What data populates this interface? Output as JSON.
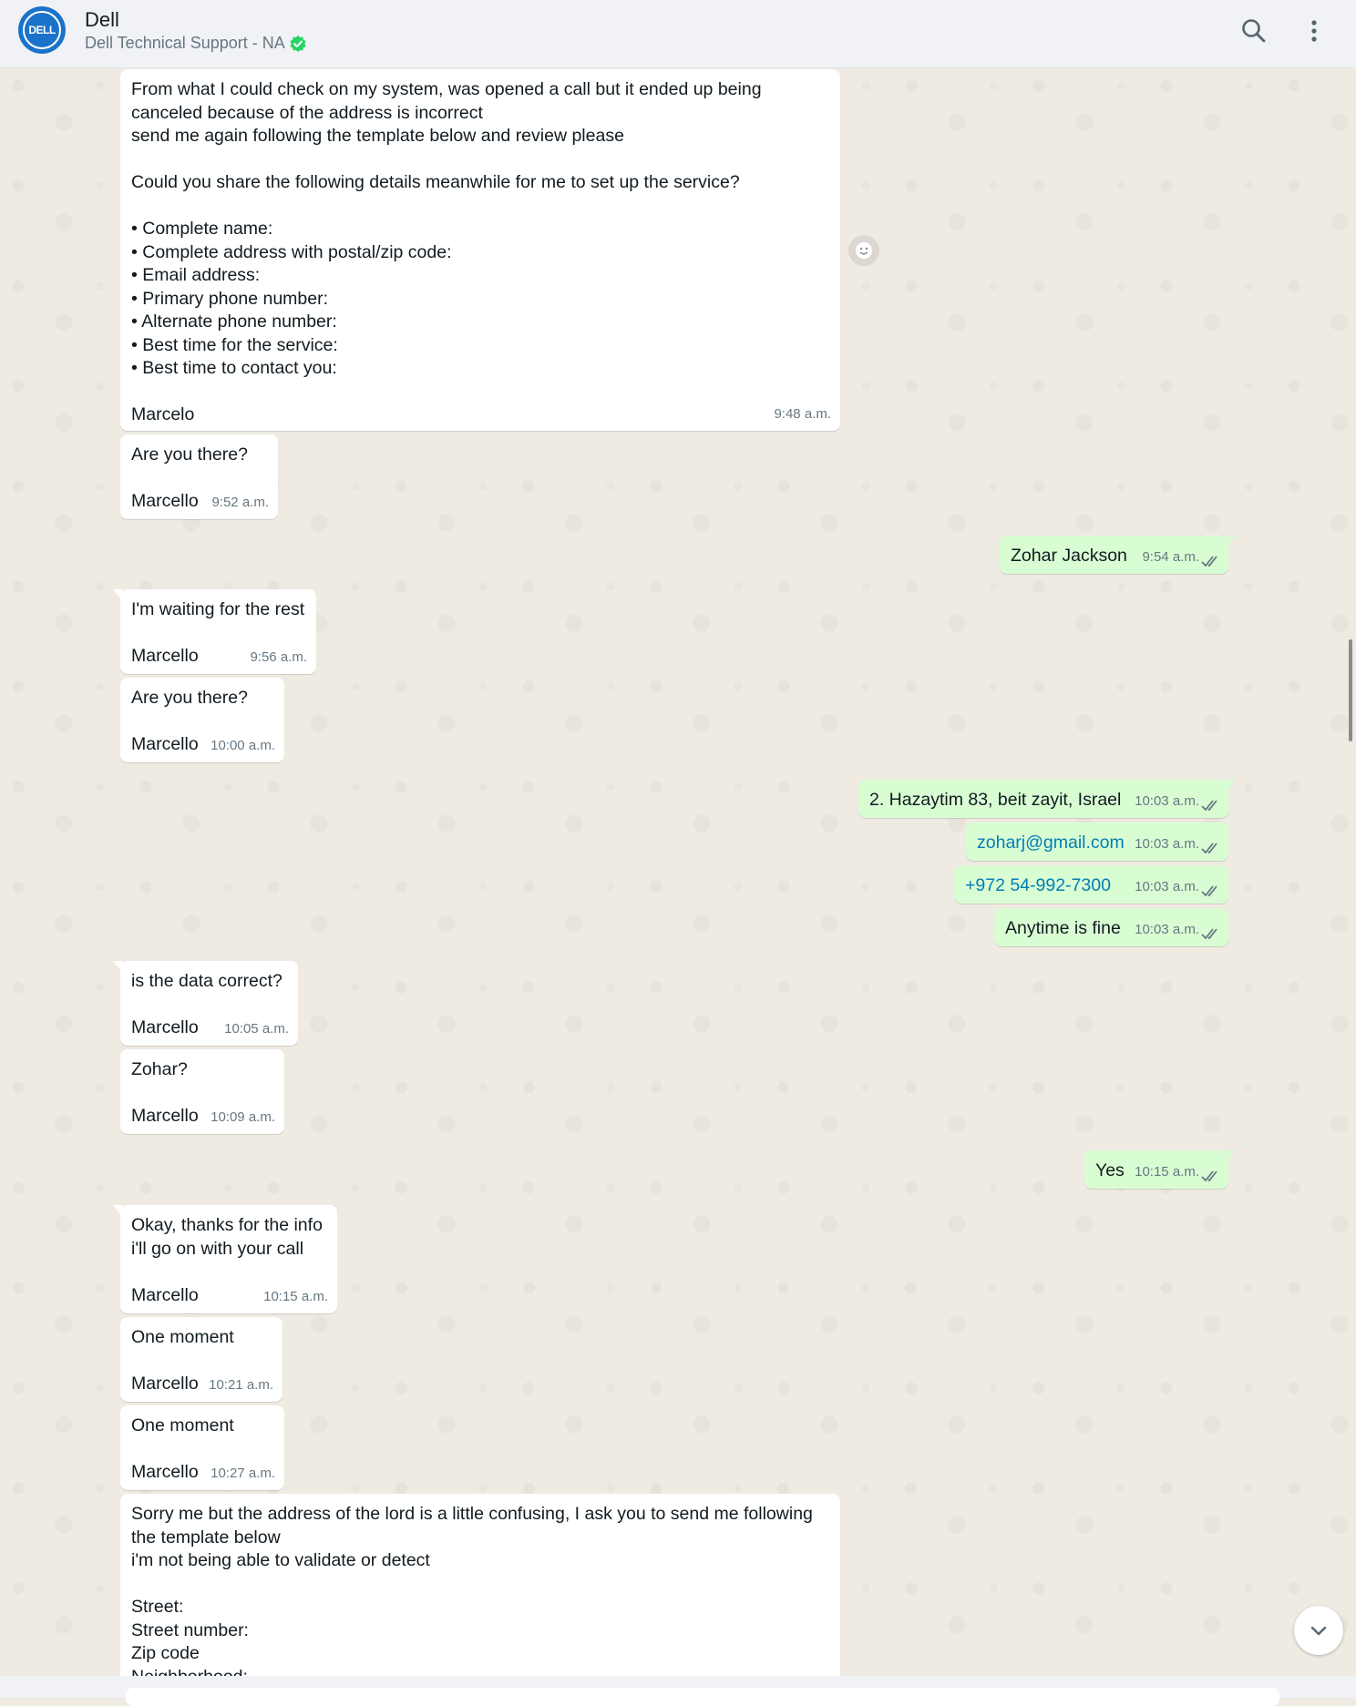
{
  "header": {
    "name": "Dell",
    "subtitle": "Dell Technical Support - NA",
    "avatar_text": "DELL"
  },
  "colors": {
    "incoming": "#ffffff",
    "outgoing": "#d9fdd3",
    "link": "#027eb5",
    "verified": "#25d366",
    "brand": "#1a73c9"
  },
  "messages": [
    {
      "dir": "in",
      "text": "From what I could check on my system, was opened a call but it ended up being\ncanceled because of the address is incorrect\nsend me again following the template below and review please\n\nCould you share the following details meanwhile for me to set up the service?\n\n• Complete name:\n• Complete address with postal/zip code:\n• Email address:\n• Primary phone number:\n• Alternate phone number:\n• Best time for the service:\n• Best time to contact you:\n\nMarcelo",
      "time": "9:48 a.m."
    },
    {
      "dir": "in",
      "text": "Are you there?\n\nMarcello",
      "time": "9:52 a.m."
    },
    {
      "dir": "out",
      "text": "Zohar Jackson",
      "time": "9:54 a.m."
    },
    {
      "dir": "in",
      "text": "I'm waiting for the rest\n\nMarcello",
      "time": "9:56 a.m."
    },
    {
      "dir": "in",
      "text": "Are you there?\n\nMarcello",
      "time": "10:00 a.m."
    },
    {
      "dir": "out",
      "text": "2. Hazaytim 83, beit zayit, Israel",
      "time": "10:03 a.m."
    },
    {
      "dir": "out",
      "text": "zoharj@gmail.com",
      "time": "10:03 a.m."
    },
    {
      "dir": "out",
      "text": "+972 54-992-7300",
      "time": "10:03 a.m."
    },
    {
      "dir": "out",
      "text": "Anytime is fine",
      "time": "10:03 a.m."
    },
    {
      "dir": "in",
      "text": "is the data correct?\n\nMarcello",
      "time": "10:05 a.m."
    },
    {
      "dir": "in",
      "text": "Zohar?\n\nMarcello",
      "time": "10:09 a.m."
    },
    {
      "dir": "out",
      "text": "Yes",
      "time": "10:15 a.m."
    },
    {
      "dir": "in",
      "text": "Okay, thanks for the info\ni'll go on with your call\n\nMarcello",
      "time": "10:15 a.m."
    },
    {
      "dir": "in",
      "text": "One moment\n\nMarcello",
      "time": "10:21 a.m."
    },
    {
      "dir": "in",
      "text": "One moment\n\nMarcello",
      "time": "10:27 a.m."
    },
    {
      "dir": "in",
      "text": "Sorry me but the address of the lord is a little confusing, I ask you to send me following\nthe template below\ni'm not being able to validate or detect\n\nStreet:\nStreet number:\nZip code\nNeighborhood:",
      "time": ""
    }
  ]
}
